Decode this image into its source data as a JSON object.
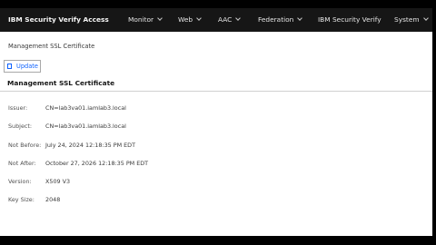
{
  "header": {
    "brand": "IBM Security Verify Access",
    "nav": [
      {
        "label": "Monitor"
      },
      {
        "label": "Web"
      },
      {
        "label": "AAC"
      },
      {
        "label": "Federation"
      },
      {
        "label": "IBM Security Verify"
      },
      {
        "label": "System"
      }
    ]
  },
  "page": {
    "title": "Management SSL Certificate",
    "update_label": "Update",
    "section_title": "Management SSL Certificate"
  },
  "details": [
    {
      "label": "Issuer:",
      "value": "CN=lab3va01.iamlab3.local"
    },
    {
      "label": "Subject:",
      "value": "CN=lab3va01.iamlab3.local"
    },
    {
      "label": "Not Before:",
      "value": "July 24, 2024 12:18:35 PM EDT"
    },
    {
      "label": "Not After:",
      "value": "October 27, 2026 12:18:35 PM EDT"
    },
    {
      "label": "Version:",
      "value": "X509 V3"
    },
    {
      "label": "Key Size:",
      "value": "2048"
    }
  ],
  "colors": {
    "nav_background": "#161616",
    "accent": "#0f62fe"
  }
}
